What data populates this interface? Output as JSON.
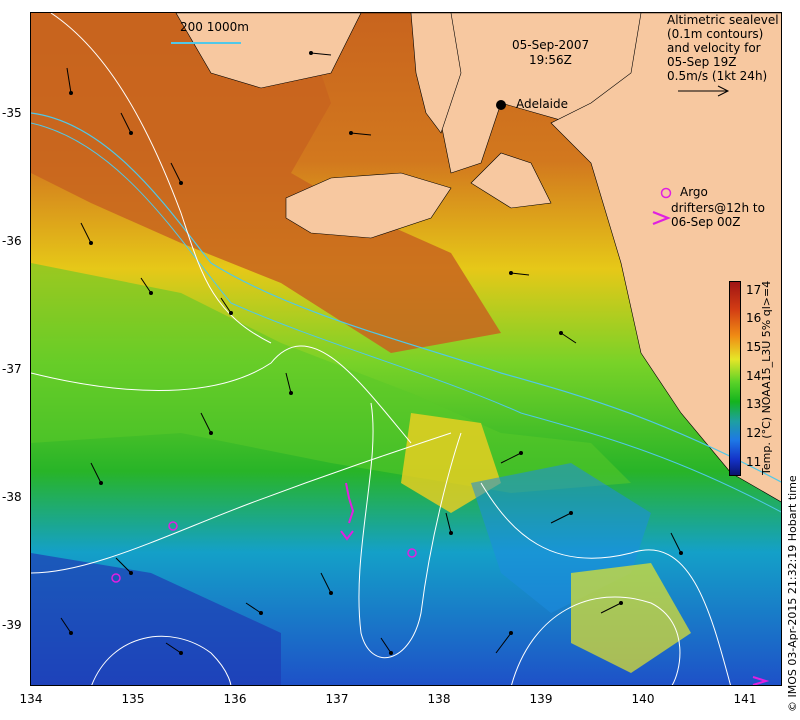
{
  "map": {
    "date": "05-Sep-2007",
    "time": "19:56Z",
    "bathymetry_label": "200 1000m",
    "city": "Adelaide",
    "altimetry": {
      "line1": "Altimetric sealevel",
      "line2": "(0.1m contours)",
      "line3": "and velocity for",
      "line4": "05-Sep 19Z",
      "line5": "0.5m/s (1kt 24h)"
    },
    "argo": {
      "label": "Argo",
      "drifters_line1": "drifters@12h to",
      "drifters_line2": "06-Sep 00Z"
    },
    "colorbar": {
      "title": "Temp. (°C) NOAA15_L3U 5% ql>=4",
      "ticks": [
        "17",
        "16",
        "15",
        "14",
        "13",
        "12",
        "11"
      ],
      "range": [
        10.5,
        17.3
      ]
    },
    "credit": "© IMOS 03-Apr-2015 21:32:19 Hobart time",
    "axis": {
      "x_ticks": [
        "134",
        "135",
        "136",
        "137",
        "138",
        "139",
        "140",
        "141"
      ],
      "y_ticks": [
        "-35",
        "-36",
        "-37",
        "-38",
        "-39"
      ]
    },
    "colors": {
      "land": "#f7c8a0",
      "warm": "#c8641e",
      "mid": "#28b828",
      "cool": "#1e6ee0",
      "argo": "#e020e0",
      "bathy": "#50c8e8"
    }
  }
}
